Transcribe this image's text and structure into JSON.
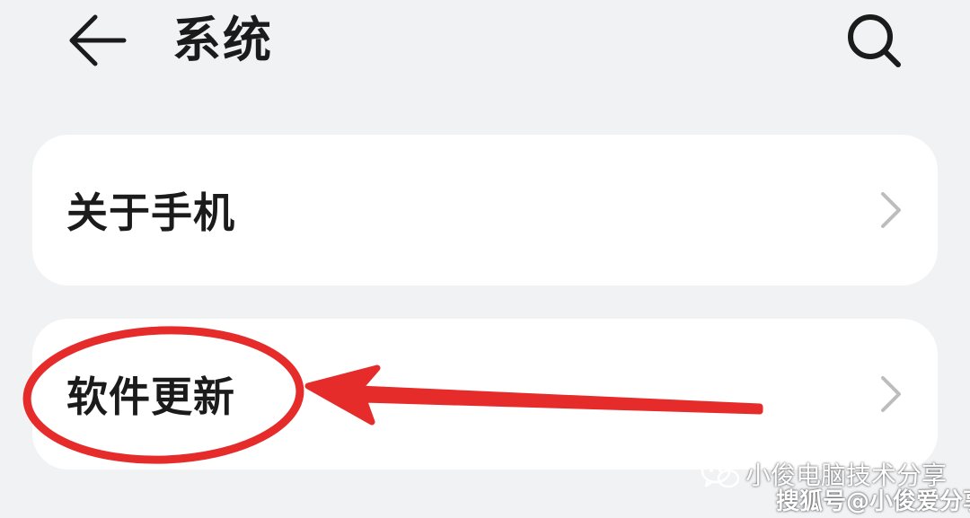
{
  "header": {
    "title": "系统",
    "back_icon": "arrow-left-icon",
    "search_icon": "search-icon"
  },
  "settings": {
    "items": [
      {
        "label": "关于手机",
        "icon": "chevron-right-icon"
      },
      {
        "label": "软件更新",
        "icon": "chevron-right-icon"
      }
    ]
  },
  "annotation": {
    "color": "#e62b2b"
  },
  "watermarks": {
    "line1": "小俊电脑技术分享",
    "line2": "搜狐号@小俊爱分享",
    "logo": "wechat-logo"
  },
  "colors": {
    "background": "#f1f2f4",
    "card": "#ffffff",
    "text": "#1b1b1b",
    "chevron": "#bdbdbd"
  }
}
